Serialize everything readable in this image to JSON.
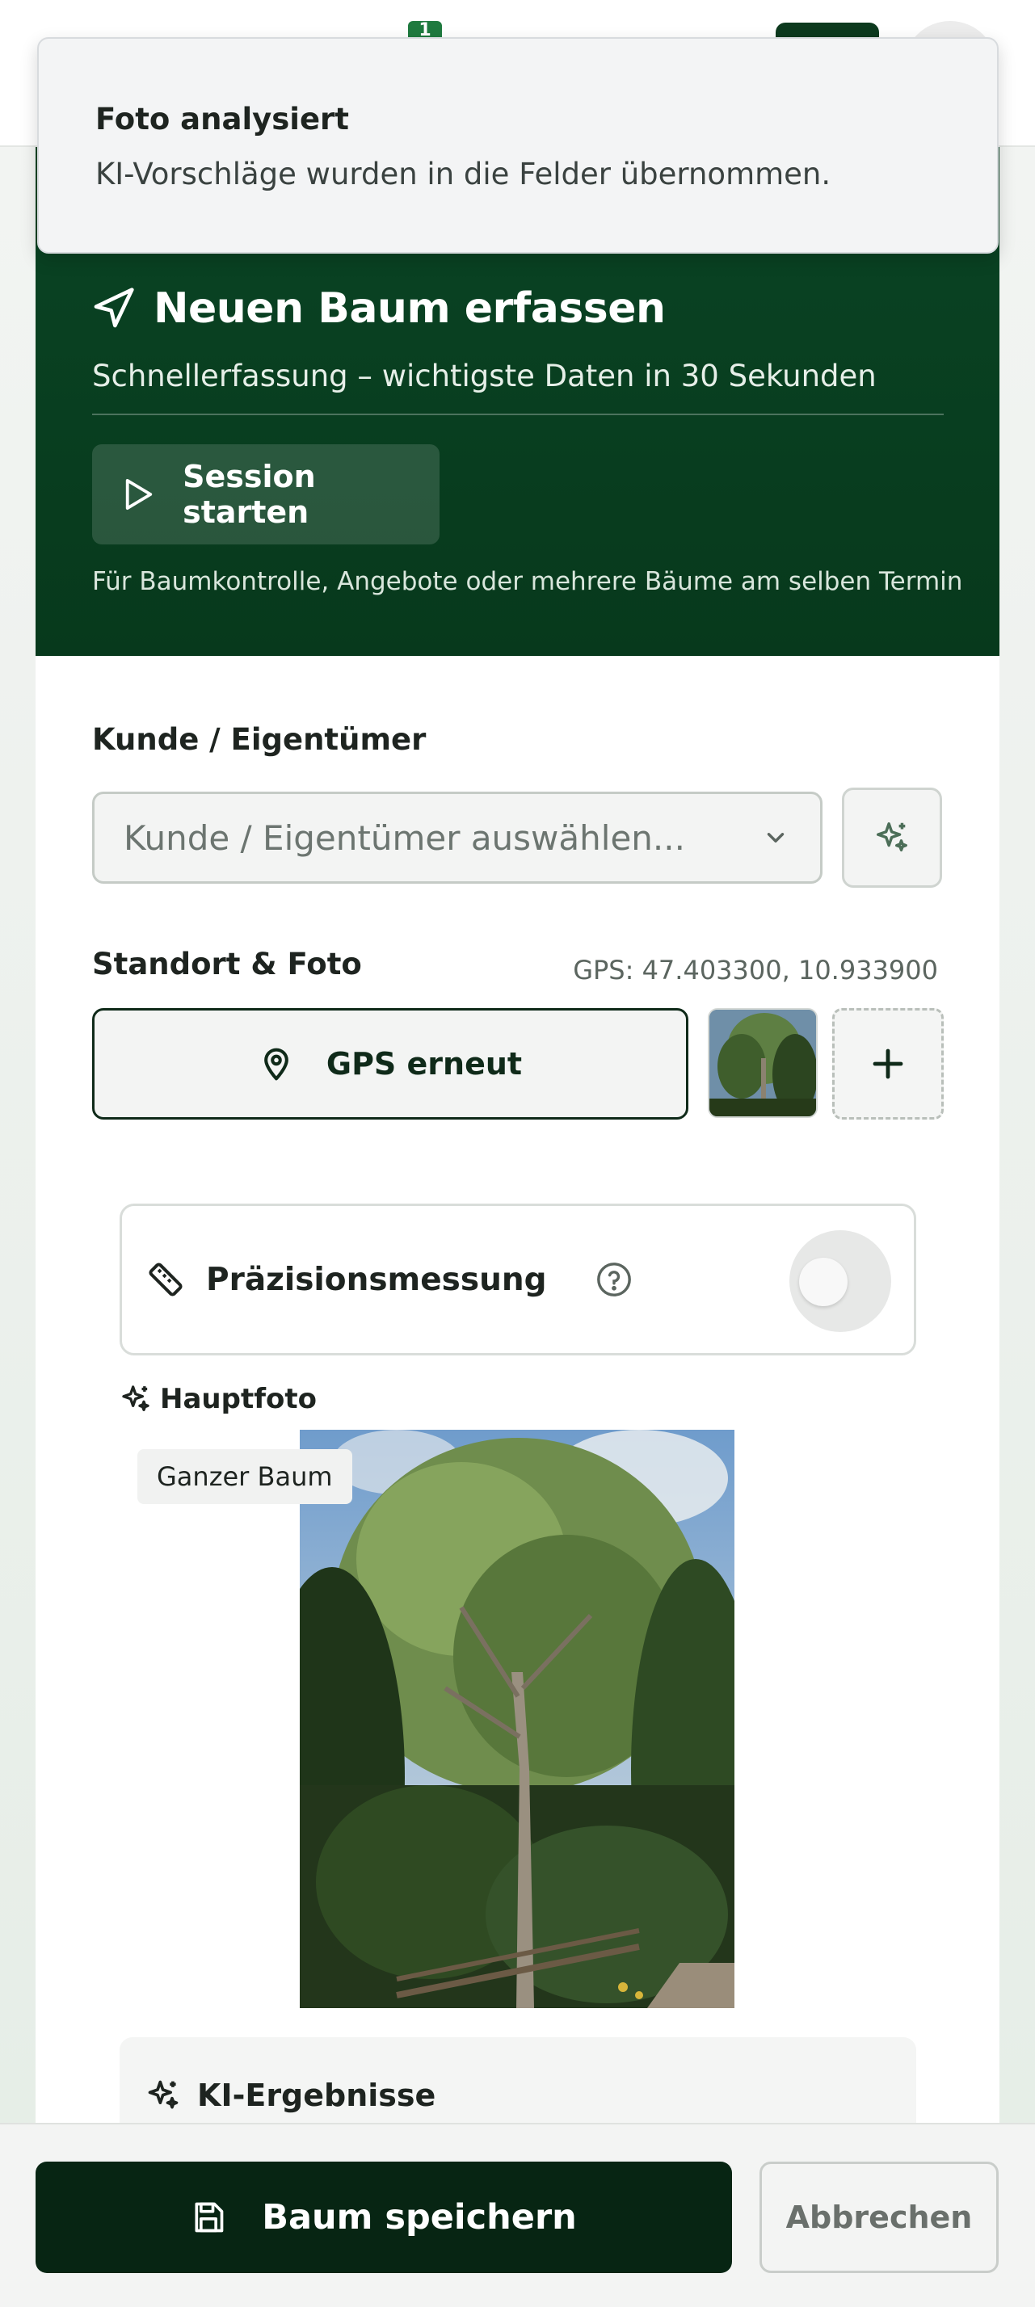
{
  "header": {
    "notification_count": "1"
  },
  "toast": {
    "title": "Foto analysiert",
    "message": "KI-Vorschläge wurden in die Felder übernommen."
  },
  "hero": {
    "title": "Neuen Baum erfassen",
    "subtitle": "Schnellerfassung – wichtigste Daten in 30 Sekunden",
    "session_button": "Session starten",
    "hint": "Für Baumkontrolle, Angebote oder mehrere Bäume am selben Termin"
  },
  "customer": {
    "label": "Kunde / Eigentümer",
    "placeholder": "Kunde / Eigentümer auswählen..."
  },
  "location": {
    "label": "Standort & Foto",
    "gps": "GPS: 47.403300, 10.933900",
    "gps_button": "GPS erneut"
  },
  "precision": {
    "label": "Präzisionsmessung",
    "enabled": false
  },
  "main_photo": {
    "label": "Hauptfoto",
    "tag": "Ganzer Baum"
  },
  "ki_results": {
    "label": "KI-Ergebnisse"
  },
  "actions": {
    "save": "Baum speichern",
    "cancel": "Abbrechen"
  },
  "colors": {
    "brand_dark": "#07391c",
    "primary_button": "#072513",
    "badge": "#1f7a3f"
  },
  "icons": {
    "hero": "navigation-arrow-icon",
    "session": "play-icon",
    "ai": "sparkles-icon",
    "dropdown": "chevron-down-icon",
    "gps": "map-pin-icon",
    "add": "plus-icon",
    "precision": "ruler-icon",
    "help": "help-circle-icon",
    "save": "save-icon"
  }
}
